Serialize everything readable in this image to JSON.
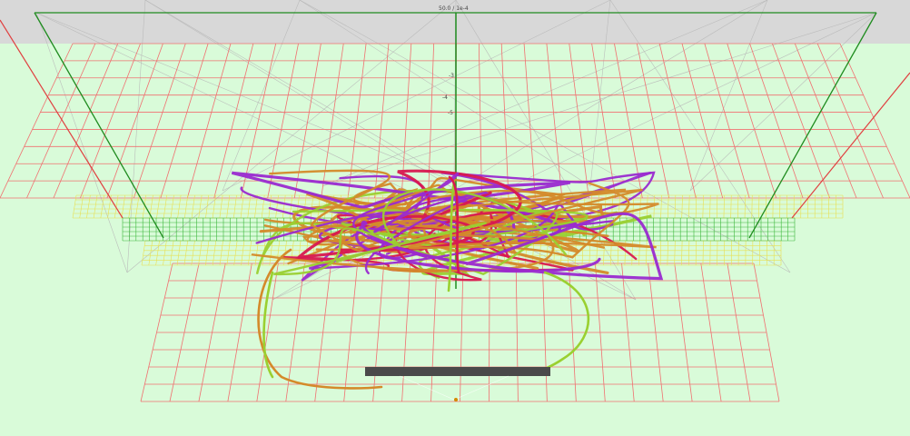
{
  "viewport": {
    "label_top": "50.0 / 1e-4",
    "axis_ticks": [
      "-3",
      "-4",
      "-5"
    ],
    "origin_label": ""
  },
  "colors": {
    "background": "#d9fbd9",
    "ceiling": "#d8d8d8",
    "floor_grid": "#f07070",
    "room_edges": "#1f8c1f",
    "perspective_lines": "#b8b8b8",
    "center_axis": "#1f8c1f",
    "yellow_grid": "#e8e050",
    "green_grid": "#3cb83c",
    "path_orange": "#d48a2a",
    "path_purple": "#9a2ad0",
    "path_green": "#9ad030",
    "path_red": "#d81850",
    "bar": "#4a4a4a"
  },
  "icons": {
    "origin_marker": "origin-marker-icon"
  }
}
